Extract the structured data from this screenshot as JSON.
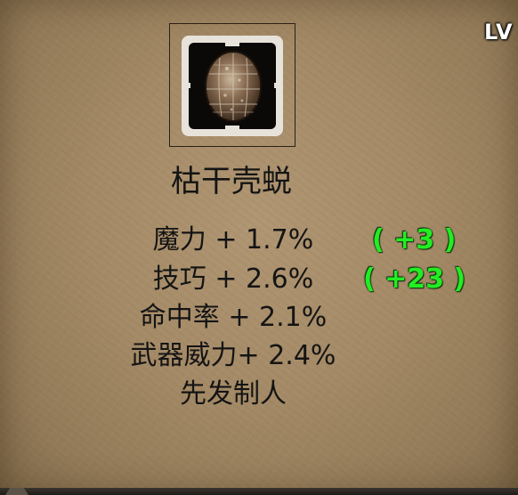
{
  "hud": {
    "level_badge": "LV"
  },
  "item": {
    "icon": "tortoise-shell-icon",
    "name": "枯干壳蜕",
    "stats": [
      {
        "label": "魔力 + 1.7%",
        "bonus": "( +3 )"
      },
      {
        "label": "技巧 + 2.6%",
        "bonus": "( +23 )"
      },
      {
        "label": "命中率 + 2.1%",
        "bonus": ""
      },
      {
        "label": "武器威力+ 2.4%",
        "bonus": ""
      },
      {
        "label": "先发制人",
        "bonus": ""
      }
    ]
  },
  "colors": {
    "parchment": "#a48a66",
    "text": "#141414",
    "bonus": "#22ee22",
    "slot_frame": "#e7e3da"
  }
}
